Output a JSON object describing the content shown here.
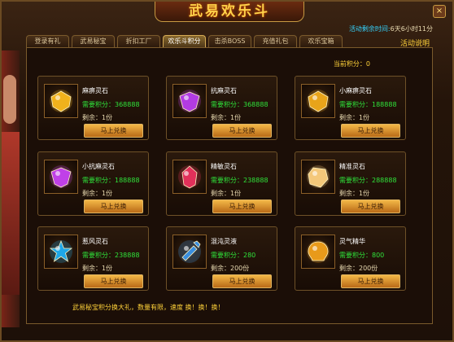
{
  "title": "武易欢乐斗",
  "close_label": "×",
  "countdown": {
    "label": "活动剩余时间:",
    "value": "6天6小时11分"
  },
  "rules_link": "活动说明",
  "tabs": [
    "登录有礼",
    "武易秘宝",
    "折扣工厂",
    "欢乐斗积分",
    "击杀BOSS",
    "充值礼包",
    "欢乐宝箱"
  ],
  "active_tab": 3,
  "points": "当前积分：0",
  "items": [
    {
      "name": "麻痹灵石",
      "req": "需要积分：368888",
      "remain": "剩余：1份",
      "button": "马上兑换",
      "icon": "yellow-gem-icon",
      "color": "#f0b21c"
    },
    {
      "name": "抗麻灵石",
      "req": "需要积分：368888",
      "remain": "剩余：1份",
      "button": "马上兑换",
      "icon": "purple-gem-icon",
      "color": "#b23be3"
    },
    {
      "name": "小麻痹灵石",
      "req": "需要积分：188888",
      "remain": "剩余：1份",
      "button": "马上兑换",
      "icon": "yellow-gem-icon",
      "color": "#e8a41a"
    },
    {
      "name": "小抗麻灵石",
      "req": "需要积分：188888",
      "remain": "剩余：1份",
      "button": "马上兑换",
      "icon": "purple-gem-icon",
      "color": "#c040e8"
    },
    {
      "name": "精敏灵石",
      "req": "需要积分：238888",
      "remain": "剩余：1份",
      "button": "马上兑换",
      "icon": "red-gem-icon",
      "color": "#e2305a"
    },
    {
      "name": "精准灵石",
      "req": "需要积分：288888",
      "remain": "剩余：1份",
      "button": "马上兑换",
      "icon": "gold-gem-icon",
      "color": "#f4c87a"
    },
    {
      "name": "惹风灵石",
      "req": "需要积分：238888",
      "remain": "剩余：1份",
      "button": "马上兑换",
      "icon": "blue-star-gem-icon",
      "color": "#1ea7e8"
    },
    {
      "name": "混沌灵液",
      "req": "需要积分：280",
      "remain": "剩余：200份",
      "button": "马上兑换",
      "icon": "potion-icon",
      "color": "#3a8fe0"
    },
    {
      "name": "灵气精华",
      "req": "需要积分：800",
      "remain": "剩余：200份",
      "button": "马上兑换",
      "icon": "skull-essence-icon",
      "color": "#e89a1a"
    }
  ],
  "footer": "武易秘宝积分换大礼，数量有限，速度 换！换！换！"
}
